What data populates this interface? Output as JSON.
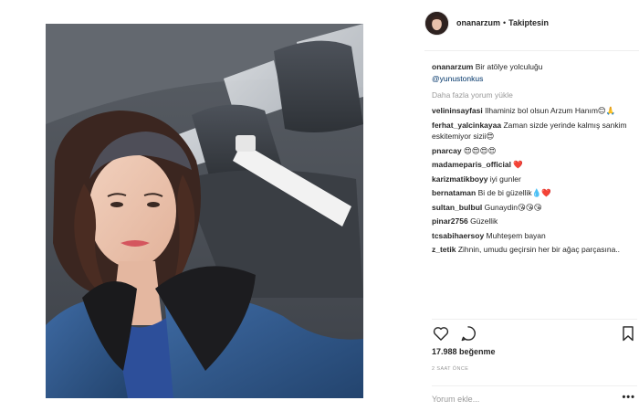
{
  "post": {
    "owner": "onanarzum",
    "dot": "•",
    "follow_state": "Takiptesin",
    "caption": "Bir atölye yolculuğu",
    "caption_mention": "@yunustonkus",
    "load_more": "Daha fazla yorum yükle",
    "comments": [
      {
        "user": "velininsayfasi",
        "text": "Ilhaminiz bol olsun Arzum Hanım😊🙏"
      },
      {
        "user": "ferhat_yalcinkayaa",
        "text": "Zaman sizde yerinde kalmış sankim eskitemiyor sizii😍"
      },
      {
        "user": "pnarcay",
        "text": "😍😍😍😍"
      },
      {
        "user": "madameparis_official",
        "text": "❤️"
      },
      {
        "user": "karizmatikboyy",
        "text": "iyi gunler"
      },
      {
        "user": "bernataman",
        "text": "Bi de bi güzellik💧❤️"
      },
      {
        "user": "sultan_bulbul",
        "text": "Gunaydin😘😘😘"
      },
      {
        "user": "pinar2756",
        "text": "Güzellik"
      },
      {
        "user": "tcsabihaersoy",
        "text": "Muhteşem bayan"
      },
      {
        "user": "z_tetik",
        "text": "Zihnin, umudu geçirsin her bir ağaç parçasına.."
      }
    ],
    "likes": "17.988 beğenme",
    "time": "2 SAAT ÖNCE",
    "comment_placeholder": "Yorum ekle...",
    "more": "•••"
  },
  "icons": {
    "like": "heart-outline-icon",
    "comment": "speech-bubble-icon",
    "save": "bookmark-icon"
  },
  "colors": {
    "link": "#003569",
    "muted": "#999999",
    "text": "#262626",
    "divider": "#efefef"
  }
}
